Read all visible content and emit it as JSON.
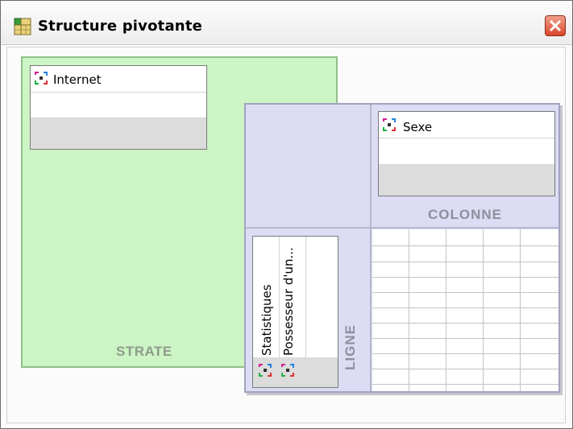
{
  "window": {
    "title": "Structure pivotante"
  },
  "zones": {
    "strate": {
      "label": "STRATE",
      "items": [
        {
          "label": "Internet",
          "icon": "pivot-dimension-icon"
        }
      ]
    },
    "colonne": {
      "label": "COLONNE",
      "items": [
        {
          "label": "Sexe",
          "icon": "pivot-dimension-icon"
        }
      ]
    },
    "ligne": {
      "label": "LIGNE",
      "items": [
        {
          "label": "Statistiques",
          "icon": "pivot-dimension-icon"
        },
        {
          "label": "Possesseur d'un...",
          "icon": "pivot-dimension-icon"
        }
      ]
    }
  },
  "colors": {
    "strate_bg": "#ccf4c4",
    "pivot_bg": "#dcdcf4",
    "close_btn": "#d9472a"
  }
}
